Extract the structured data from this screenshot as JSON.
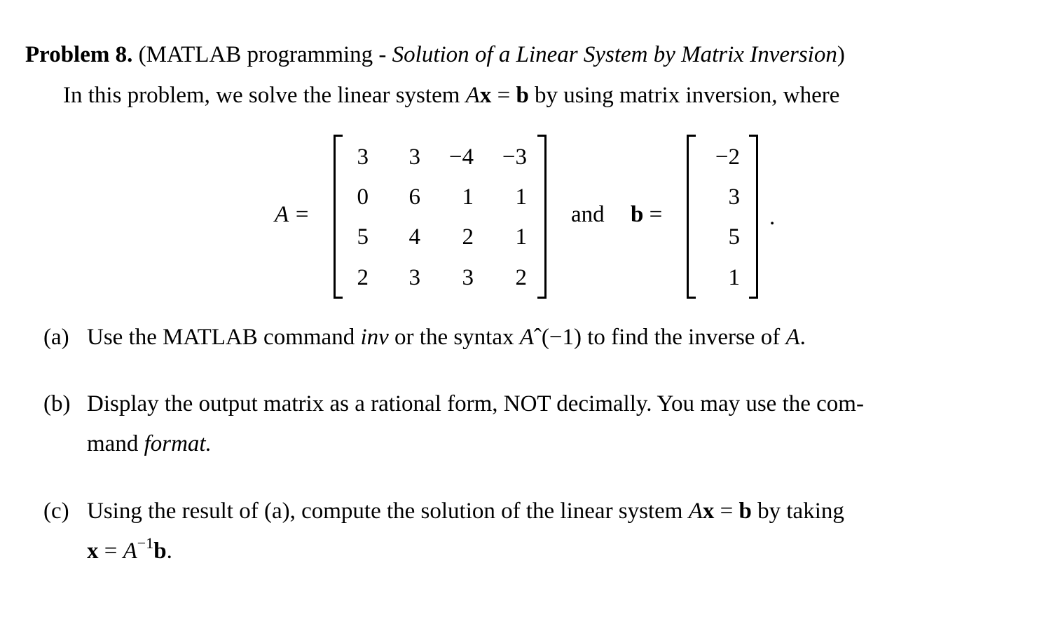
{
  "problem": {
    "heading": "Problem 8.",
    "subject_open": "(MATLAB programming - ",
    "subject_title": "Solution of a Linear System by Matrix Inversion",
    "subject_close": ")",
    "intro_pre": "In this problem, we solve the linear system ",
    "intro_A": "A",
    "intro_x": "x",
    "intro_eq": " = ",
    "intro_b": "b",
    "intro_post": " by using matrix inversion, where"
  },
  "equations": {
    "matrix_a_label": "A =",
    "matrix_a": [
      [
        "3",
        "3",
        "−4",
        "−3"
      ],
      [
        "0",
        "6",
        "1",
        "1"
      ],
      [
        "5",
        "4",
        "2",
        "1"
      ],
      [
        "2",
        "3",
        "3",
        "2"
      ]
    ],
    "and_text": "and",
    "vector_b_label_b": "b",
    "vector_b_label_eq": " =",
    "vector_b": [
      "−2",
      "3",
      "5",
      "1"
    ],
    "period": "."
  },
  "parts": {
    "a": {
      "label": "(a)",
      "text_1": "Use the MATLAB command ",
      "cmd": "inv",
      "text_2": " or the syntax ",
      "syntax_A": "A",
      "syntax_rest": "ˆ(−1)",
      "text_3": " to find the inverse of ",
      "end_A": "A",
      "end_period": "."
    },
    "b": {
      "label": "(b)",
      "line1": "Display the output matrix as a rational form, NOT decimally.  You may use the com-",
      "line2_pre": "mand ",
      "line2_cmd": "format.",
      "line2_post": ""
    },
    "c": {
      "label": "(c)",
      "line1_pre": "Using the result of (a), compute the solution of the linear system ",
      "line1_A": "A",
      "line1_x": "x",
      "line1_eq": " = ",
      "line1_b": "b",
      "line1_post": " by taking",
      "line2_x": "x",
      "line2_eq": " = ",
      "line2_A": "A",
      "line2_sup": "−1",
      "line2_b": "b",
      "line2_period": "."
    }
  }
}
